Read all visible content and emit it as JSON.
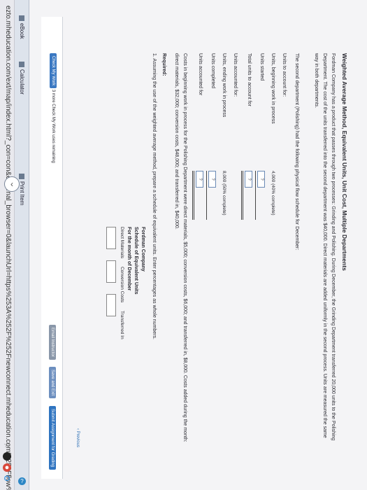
{
  "browser": {
    "url": "ezto.mheducation.com/ext/map/index.html?_con=con&external_browser=0&launchUrl=https%253A%252F%252Fnewconnect.mheducation.com%252Fflow%252Fconnect.html"
  },
  "toolbar": {
    "ebook": "eBook",
    "calculator": "Calculator",
    "print": "Print Item"
  },
  "question": {
    "title": "Weighted Average Method, Equivalent Units, Unit Cost, Multiple Departments",
    "intro": "Fordman Company has a product that passes through two processes: Grinding and Polishing. During December, the Grinding Department transferred 20,000 units to the Polishing Department. The cost of the units transferred into the second department was $40,000. Direct materials are added uniformly in the second process. Units are measured the same way in both departments.",
    "flow_intro": "The second department (Polishing) had the following physical flow schedule for December:",
    "units_to_account": "Units to account for:",
    "beg_wip": "Units, beginning work in process",
    "beg_wip_val": "4,000  (40% complete)",
    "started": "Units started",
    "total_account": "Total units to account for",
    "accounted": "Units accounted for:",
    "end_wip": "Units, ending work in process",
    "end_wip_val": "8,000  (50% complete)",
    "completed": "Units completed",
    "q_mark": "?",
    "accounted_total": "Units accounted for",
    "costs": "Costs in beginning work in process for the Polishing Department were direct materials, $5,000; conversion costs, $6,000; and transferred in, $8,000. Costs added during the month: direct materials, $32,000; conversion costs, $48,000; and transferred in, $40,000.",
    "required": "Required:",
    "req1": "1. Assuming the use of the weighted average method, prepare a schedule of equivalent units. Enter percentages as whole numbers.",
    "sched_company": "Fordman Company",
    "sched_title": "Schedule of Equivalent Units",
    "sched_period": "For the month of December",
    "col_dm": "Direct Materials",
    "col_cc": "Conversion Costs",
    "col_ti": "Transferred In"
  },
  "footer": {
    "check": "Check My Work",
    "remaining": "3 more Check My Work uses remaining",
    "previous": "Previous",
    "email": "Email Instructor",
    "save": "Save and Exit",
    "submit": "Submit Assignment for Grading"
  }
}
